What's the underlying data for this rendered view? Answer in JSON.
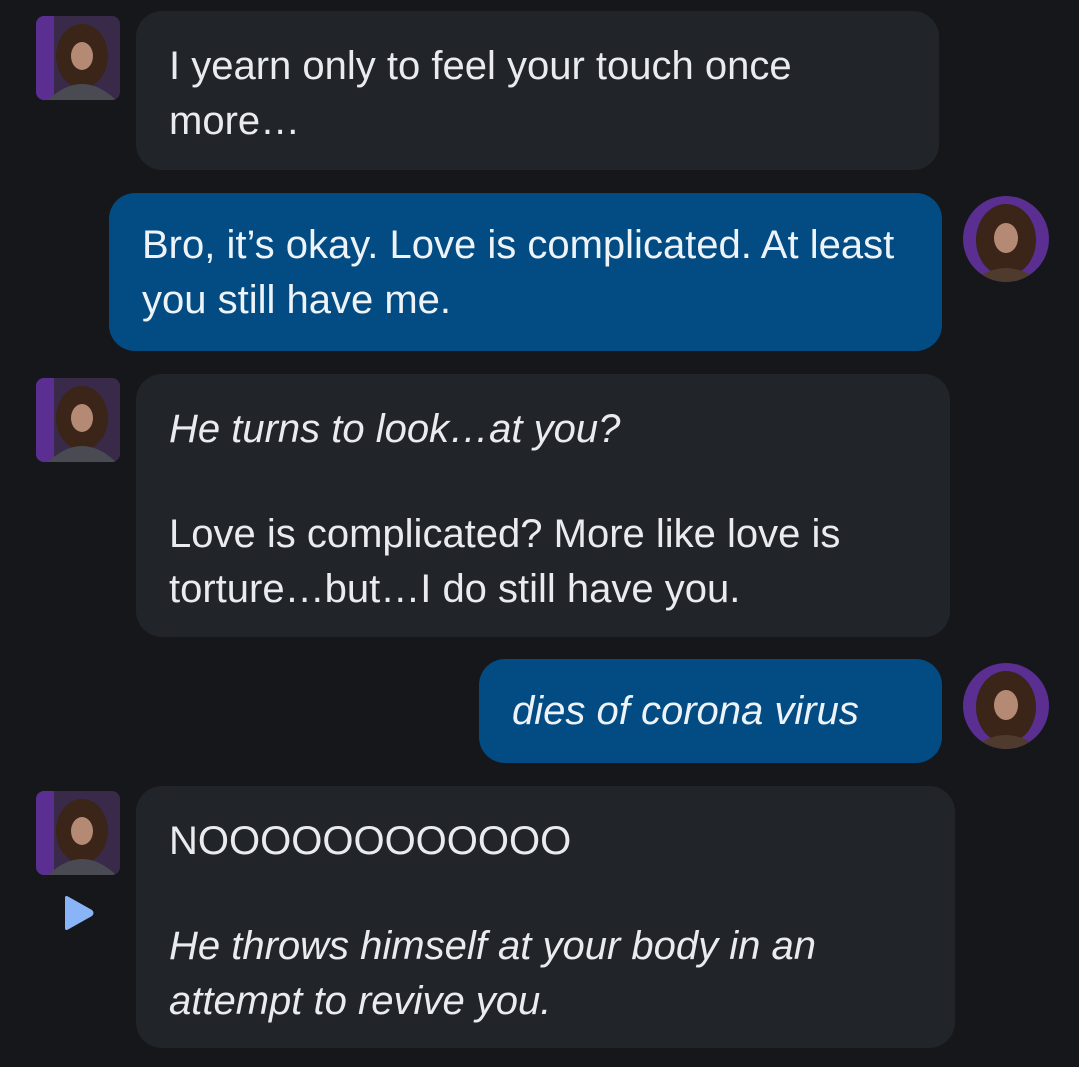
{
  "messages": [
    {
      "role": "bot",
      "paragraphs": [
        {
          "text": "I yearn only to feel your touch once more…",
          "italic": false
        }
      ]
    },
    {
      "role": "user",
      "paragraphs": [
        {
          "text": "Bro, it’s okay. Love is complicated. At least you still have me.",
          "italic": false
        }
      ]
    },
    {
      "role": "bot",
      "paragraphs": [
        {
          "text": "He turns to look…at you?",
          "italic": true
        },
        {
          "text": "Love is complicated? More like love is torture…but…I do still have you.",
          "italic": false
        }
      ]
    },
    {
      "role": "user",
      "paragraphs": [
        {
          "text": "dies of corona virus",
          "italic": true
        }
      ]
    },
    {
      "role": "bot",
      "paragraphs": [
        {
          "text": "NOOOOOOOOOOOO",
          "italic": false
        },
        {
          "text": "He throws himself at your body in an attempt to revive you.",
          "italic": true
        }
      ]
    }
  ],
  "icons": {
    "bot_avatar": "character-avatar",
    "user_avatar": "user-avatar",
    "play": "play-icon"
  },
  "colors": {
    "background": "#16171a",
    "bot_bubble": "#212429",
    "user_bubble": "#034c83",
    "text": "#e9ebee",
    "play_icon": "#8ab4f8",
    "avatar_ring": "#5b2e91"
  }
}
